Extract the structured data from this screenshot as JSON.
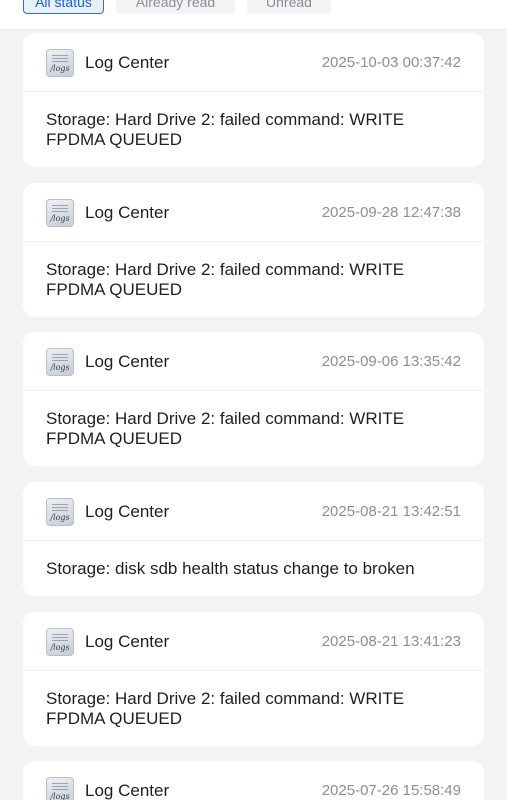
{
  "filters": {
    "all": "All status",
    "read": "Already read",
    "unread": "Unread",
    "active": "all"
  },
  "notifications": [
    {
      "app": "Log Center",
      "icon_text": "/logs",
      "timestamp": "2025-10-03 00:37:42",
      "message": "Storage: Hard Drive 2: failed command: WRITE FPDMA QUEUED"
    },
    {
      "app": "Log Center",
      "icon_text": "/logs",
      "timestamp": "2025-09-28 12:47:38",
      "message": "Storage: Hard Drive 2: failed command: WRITE FPDMA QUEUED"
    },
    {
      "app": "Log Center",
      "icon_text": "/logs",
      "timestamp": "2025-09-06 13:35:42",
      "message": "Storage: Hard Drive 2: failed command: WRITE FPDMA QUEUED"
    },
    {
      "app": "Log Center",
      "icon_text": "/logs",
      "timestamp": "2025-08-21 13:42:51",
      "message": "Storage: disk sdb health status change to broken"
    },
    {
      "app": "Log Center",
      "icon_text": "/logs",
      "timestamp": "2025-08-21 13:41:23",
      "message": "Storage: Hard Drive 2: failed command: WRITE FPDMA QUEUED"
    },
    {
      "app": "Log Center",
      "icon_text": "/logs",
      "timestamp": "2025-07-26 15:58:49",
      "message": ""
    }
  ]
}
